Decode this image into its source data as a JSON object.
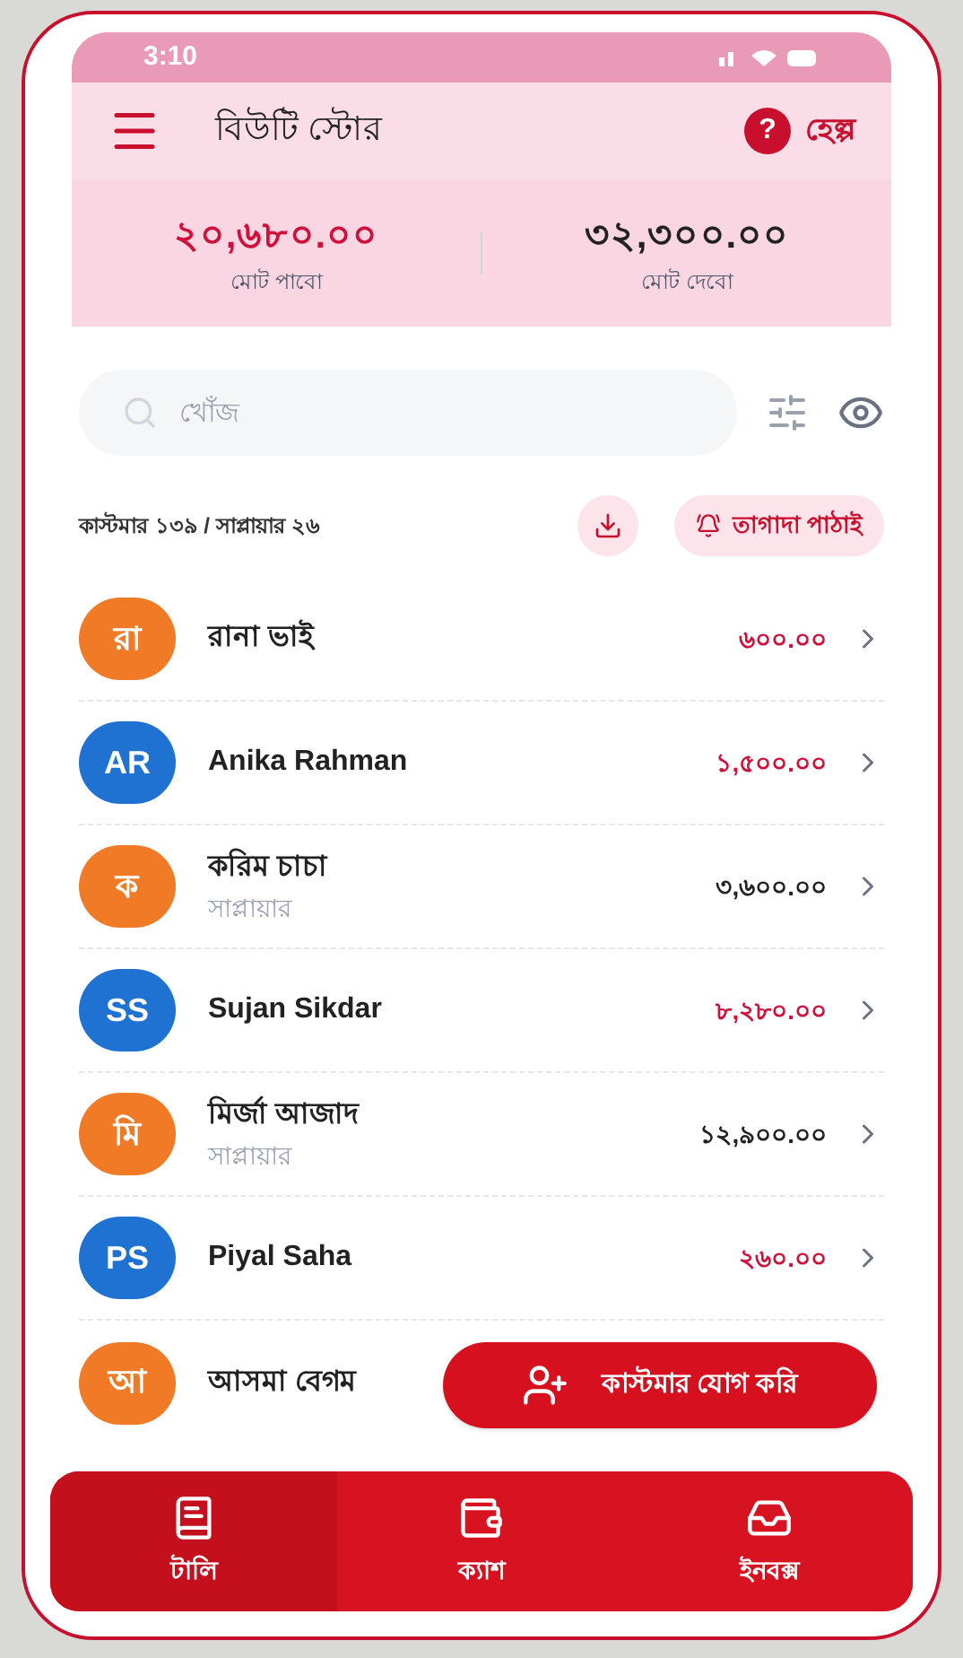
{
  "status_bar": {
    "time": "3:10"
  },
  "header": {
    "title": "বিউটি স্টোর",
    "help_mark": "?",
    "help": "হেল্প"
  },
  "summary": [
    {
      "amount": "২০,৬৮০.০০",
      "label": "মোট পাবো",
      "kind": "receivable"
    },
    {
      "amount": "৩২,৩০০.০০",
      "label": "মোট দেবো",
      "kind": "payable"
    }
  ],
  "search": {
    "placeholder": "খোঁজ"
  },
  "counts": "কাস্টমার ১৩৯ / সাপ্লায়ার ২৬",
  "reminder_button": "তাগাদা পাঠাই",
  "contacts": [
    {
      "initials": "রা",
      "color": "#f07a26",
      "name": "রানা ভাই",
      "amount": "৬০০.০০",
      "kind": "receivable"
    },
    {
      "initials": "AR",
      "color": "#1f72d1",
      "name": "Anika Rahman",
      "amount": "১,৫০০.০০",
      "kind": "receivable"
    },
    {
      "initials": "ক",
      "color": "#f07a26",
      "name": "করিম চাচা",
      "subtitle": "সাপ্লায়ার",
      "amount": "৩,৬০০.০০",
      "kind": "payable"
    },
    {
      "initials": "SS",
      "color": "#1f72d1",
      "name": "Sujan Sikdar",
      "amount": "৮,২৮০.০০",
      "kind": "receivable"
    },
    {
      "initials": "মি",
      "color": "#f07a26",
      "name": "মির্জা আজাদ",
      "subtitle": "সাপ্লায়ার",
      "amount": "১২,৯০০.০০",
      "kind": "payable"
    },
    {
      "initials": "PS",
      "color": "#1f72d1",
      "name": "Piyal Saha",
      "amount": "২৬০.০০",
      "kind": "receivable"
    },
    {
      "initials": "আ",
      "color": "#f07a26",
      "name": "আসমা বেগম"
    }
  ],
  "add_button": "কাস্টমার যোগ করি",
  "bottom_nav": [
    {
      "label": "টালি",
      "kind": "ledger",
      "selected": true
    },
    {
      "label": "ক্যাশ",
      "kind": "cash",
      "selected": false
    },
    {
      "label": "ইনবক্স",
      "kind": "inbox",
      "selected": false
    }
  ]
}
